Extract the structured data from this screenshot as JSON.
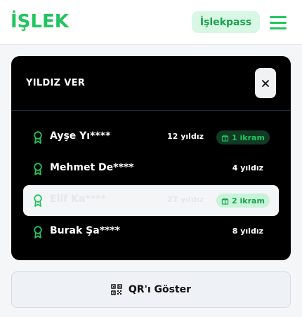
{
  "header": {
    "logo": "İŞLEK",
    "pass_button": "İşlekpass",
    "menu_icon": "hamburger-icon"
  },
  "panel": {
    "title": "YILDIZ VER",
    "close_icon": "close-icon",
    "items": [
      {
        "name": "Ayşe Yı****",
        "stars": "12 yıldız",
        "badge": "1 ikram"
      },
      {
        "name": "Mehmet De****",
        "stars": "4 yıldız",
        "badge": ""
      },
      {
        "name": "Elif Ka****",
        "stars": "27 yıldız",
        "badge": "2 ikram"
      },
      {
        "name": "Burak Şa****",
        "stars": "8 yıldız",
        "badge": ""
      }
    ]
  },
  "qr_button": "QR'ı Göster",
  "colors": {
    "brand": "#22c55e",
    "panel_bg": "#000000",
    "selected_row_bg": "#f4f5f7"
  }
}
